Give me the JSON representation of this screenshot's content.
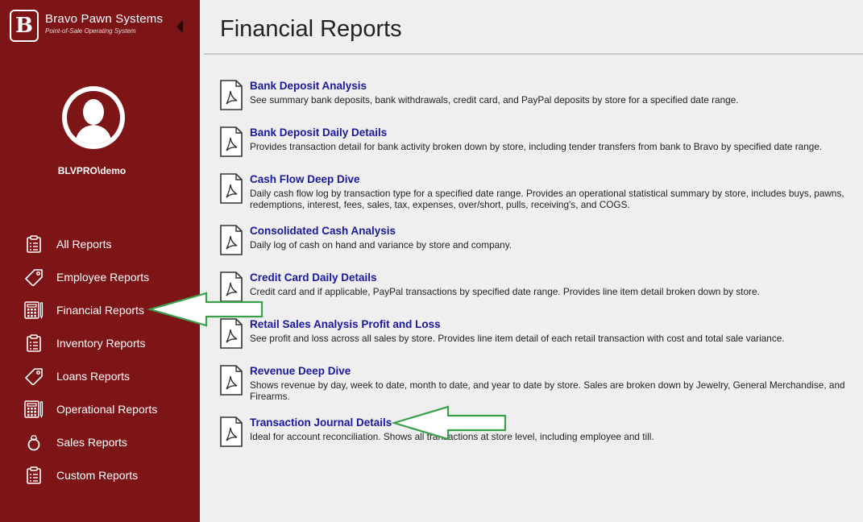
{
  "brand": {
    "logo_letter": "B",
    "name": "Bravo Pawn Systems",
    "tagline": "Point-of-Sale Operating System"
  },
  "user": {
    "name": "BLVPRO\\demo"
  },
  "nav": [
    {
      "label": "All Reports",
      "icon": "clipboard-icon"
    },
    {
      "label": "Employee Reports",
      "icon": "tag-icon"
    },
    {
      "label": "Financial Reports",
      "icon": "calculator-icon"
    },
    {
      "label": "Inventory Reports",
      "icon": "clipboard-icon"
    },
    {
      "label": "Loans Reports",
      "icon": "tag-icon"
    },
    {
      "label": "Operational Reports",
      "icon": "calculator-icon"
    },
    {
      "label": "Sales Reports",
      "icon": "ring-icon"
    },
    {
      "label": "Custom Reports",
      "icon": "clipboard-icon"
    }
  ],
  "page": {
    "title": "Financial Reports"
  },
  "reports": [
    {
      "title": "Bank Deposit Analysis",
      "desc": "See summary bank deposits, bank withdrawals, credit card, and PayPal deposits by store for a specified date range."
    },
    {
      "title": "Bank Deposit Daily Details",
      "desc": "Provides transaction detail for bank activity broken down by store, including tender transfers from bank to Bravo by specified date range."
    },
    {
      "title": "Cash Flow Deep Dive",
      "desc": "Daily cash flow log by transaction type for a specified date range. Provides an operational statistical summary by store, includes buys, pawns, redemptions, interest, fees, sales, tax, expenses, over/short, pulls, receiving's, and COGS."
    },
    {
      "title": "Consolidated Cash Analysis",
      "desc": "Daily log of cash on hand and variance by store and company."
    },
    {
      "title": "Credit Card Daily Details",
      "desc": "Credit card and if applicable, PayPal transactions by specified date range. Provides line item detail broken down by store."
    },
    {
      "title": "Retail Sales Analysis Profit and Loss",
      "desc": "See profit and loss across all sales by store. Provides line item detail of each retail transaction with cost and total sale variance."
    },
    {
      "title": "Revenue Deep Dive",
      "desc": "Shows revenue by day, week to date, month to date, and year to date by store. Sales are broken down by Jewelry, General Merchandise, and Firearms."
    },
    {
      "title": "Transaction Journal Details",
      "desc": "Ideal for account reconciliation. Shows all transactions at store level, including employee and till."
    }
  ],
  "colors": {
    "sidebar": "#7d1416",
    "link": "#1a1aa0",
    "annotation_arrow": "#3aa04a"
  }
}
